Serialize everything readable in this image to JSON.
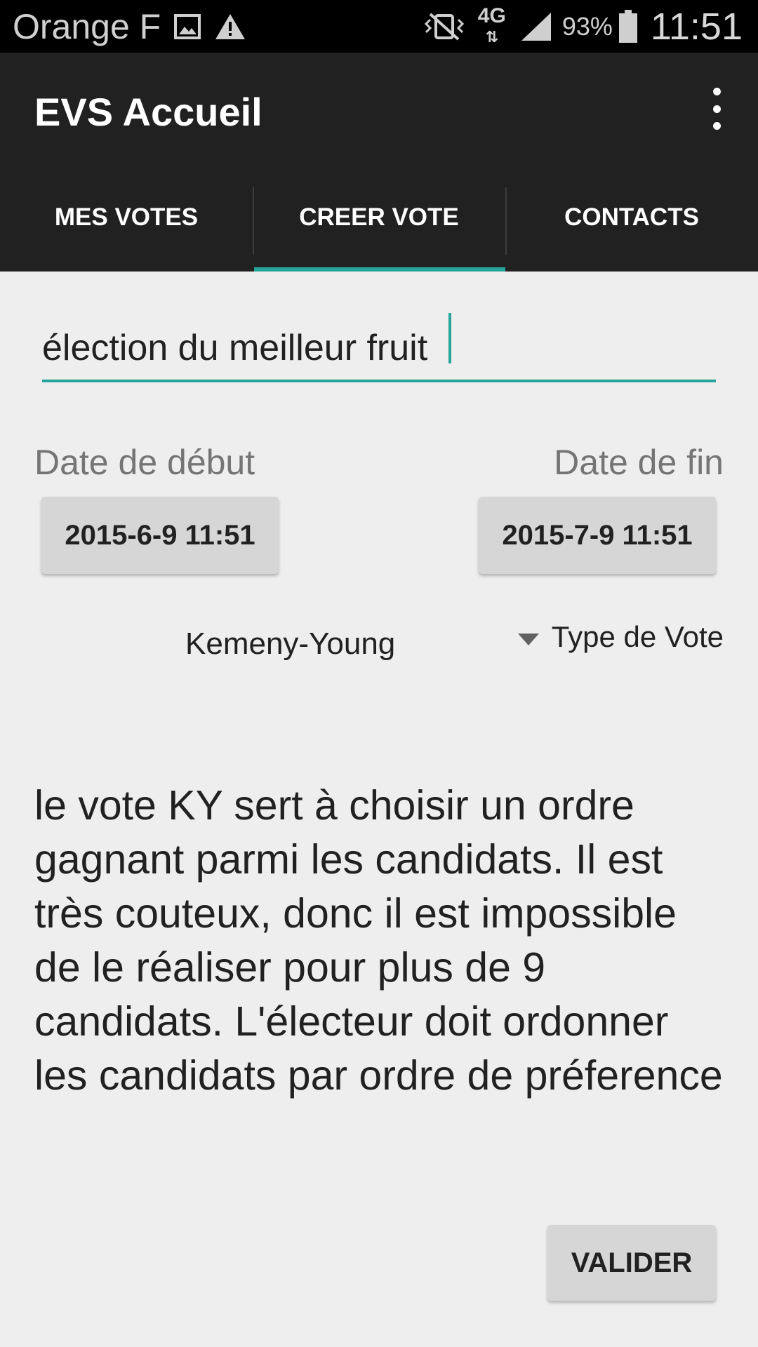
{
  "status_bar": {
    "carrier": "Orange F",
    "network": "4G",
    "battery_percent": "93%",
    "time": "11:51",
    "icons": [
      "image-icon",
      "warning-icon",
      "vibrate-icon",
      "data-arrows-icon",
      "signal-icon",
      "battery-icon"
    ]
  },
  "app_bar": {
    "title": "EVS Accueil",
    "menu_icon": "overflow-menu-icon"
  },
  "tabs": [
    {
      "label": "MES VOTES",
      "active": false
    },
    {
      "label": "CREER VOTE",
      "active": true
    },
    {
      "label": "CONTACTS",
      "active": false
    }
  ],
  "form": {
    "title_value": "élection du meilleur fruit",
    "start_date_label": "Date de début",
    "end_date_label": "Date de fin",
    "start_date_value": "2015-6-9 11:51",
    "end_date_value": "2015-7-9 11:51",
    "vote_type_value": "Kemeny-Young",
    "vote_type_label": "Type de Vote",
    "description": "le vote KY sert à choisir un ordre gagnant parmi les candidats. Il est très couteux, donc il est impossible de le réaliser pour plus de 9 candidats. L'électeur doit ordonner les candidats par ordre de préference",
    "submit_label": "VALIDER"
  },
  "colors": {
    "accent": "#26a69a",
    "toolbar": "#212121",
    "background": "#eeeeee"
  }
}
